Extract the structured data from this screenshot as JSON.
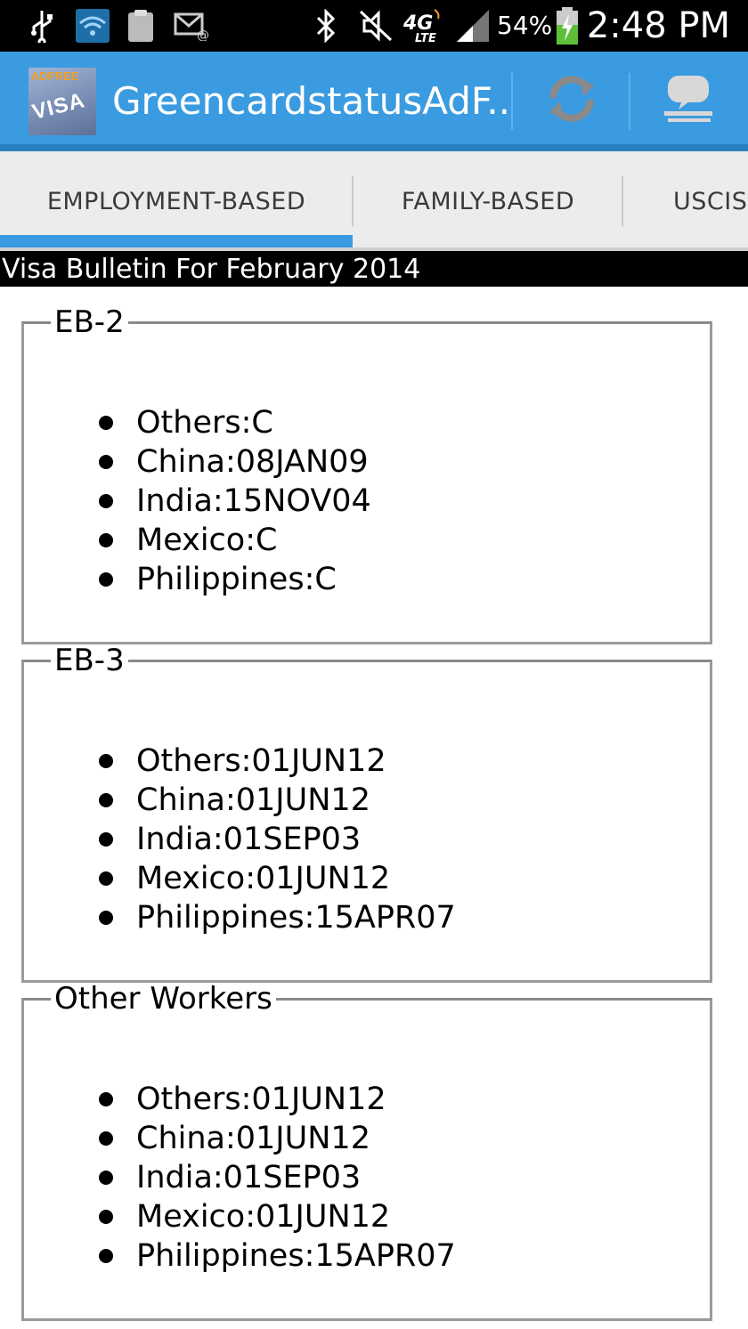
{
  "status_bar": {
    "icons": [
      "usb-icon",
      "wifi-icon",
      "clipboard-icon",
      "email-icon",
      "bluetooth-icon",
      "mute-icon",
      "4g-lte-icon",
      "signal-icon",
      "battery-icon"
    ],
    "network": "4G LTE",
    "battery_percent": "54%",
    "time": "2:48 PM"
  },
  "action_bar": {
    "app_icon_text_top": "ADFREE",
    "app_icon_text": "VISA",
    "title": "GreencardstatusAdF..",
    "actions": [
      "refresh-icon",
      "chat-icon"
    ],
    "color": "#3b9be0"
  },
  "tabs": {
    "items": [
      "EMPLOYMENT-BASED",
      "FAMILY-BASED",
      "USCIS"
    ],
    "selected": "EMPLOYMENT-BASED"
  },
  "bulletin_title": "Visa Bulletin For February 2014",
  "categories": [
    {
      "name": "EB-2",
      "items": [
        "Others:C",
        "China:08JAN09",
        "India:15NOV04",
        "Mexico:C",
        "Philippines:C"
      ]
    },
    {
      "name": "EB-3",
      "items": [
        "Others:01JUN12",
        "China:01JUN12",
        "India:01SEP03",
        "Mexico:01JUN12",
        "Philippines:15APR07"
      ]
    },
    {
      "name": "Other Workers",
      "items": [
        "Others:01JUN12",
        "China:01JUN12",
        "India:01SEP03",
        "Mexico:01JUN12",
        "Philippines:15APR07"
      ]
    }
  ]
}
